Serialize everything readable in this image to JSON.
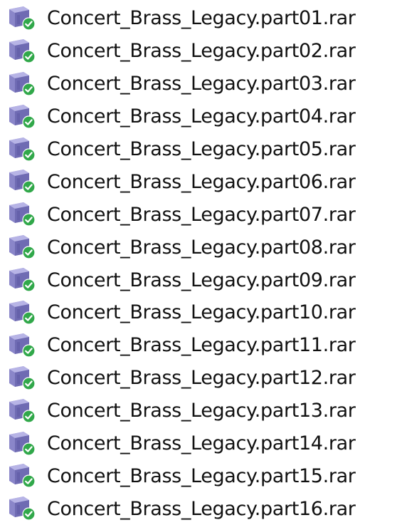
{
  "colors": {
    "text": "#111111",
    "archive_body": "#8a86c9",
    "archive_side": "#6f6bb3",
    "archive_top": "#b7b4e6",
    "badge": "#31a84a",
    "badge_check": "#ffffff"
  },
  "files": [
    {
      "name": "Concert_Brass_Legacy.part01.rar",
      "icon": "archive-icon",
      "badge": "synced-check-badge-icon"
    },
    {
      "name": "Concert_Brass_Legacy.part02.rar",
      "icon": "archive-icon",
      "badge": "synced-check-badge-icon"
    },
    {
      "name": "Concert_Brass_Legacy.part03.rar",
      "icon": "archive-icon",
      "badge": "synced-check-badge-icon"
    },
    {
      "name": "Concert_Brass_Legacy.part04.rar",
      "icon": "archive-icon",
      "badge": "synced-check-badge-icon"
    },
    {
      "name": "Concert_Brass_Legacy.part05.rar",
      "icon": "archive-icon",
      "badge": "synced-check-badge-icon"
    },
    {
      "name": "Concert_Brass_Legacy.part06.rar",
      "icon": "archive-icon",
      "badge": "synced-check-badge-icon"
    },
    {
      "name": "Concert_Brass_Legacy.part07.rar",
      "icon": "archive-icon",
      "badge": "synced-check-badge-icon"
    },
    {
      "name": "Concert_Brass_Legacy.part08.rar",
      "icon": "archive-icon",
      "badge": "synced-check-badge-icon"
    },
    {
      "name": "Concert_Brass_Legacy.part09.rar",
      "icon": "archive-icon",
      "badge": "synced-check-badge-icon"
    },
    {
      "name": "Concert_Brass_Legacy.part10.rar",
      "icon": "archive-icon",
      "badge": "synced-check-badge-icon"
    },
    {
      "name": "Concert_Brass_Legacy.part11.rar",
      "icon": "archive-icon",
      "badge": "synced-check-badge-icon"
    },
    {
      "name": "Concert_Brass_Legacy.part12.rar",
      "icon": "archive-icon",
      "badge": "synced-check-badge-icon"
    },
    {
      "name": "Concert_Brass_Legacy.part13.rar",
      "icon": "archive-icon",
      "badge": "synced-check-badge-icon"
    },
    {
      "name": "Concert_Brass_Legacy.part14.rar",
      "icon": "archive-icon",
      "badge": "synced-check-badge-icon"
    },
    {
      "name": "Concert_Brass_Legacy.part15.rar",
      "icon": "archive-icon",
      "badge": "synced-check-badge-icon"
    },
    {
      "name": "Concert_Brass_Legacy.part16.rar",
      "icon": "archive-icon",
      "badge": "synced-check-badge-icon"
    }
  ]
}
